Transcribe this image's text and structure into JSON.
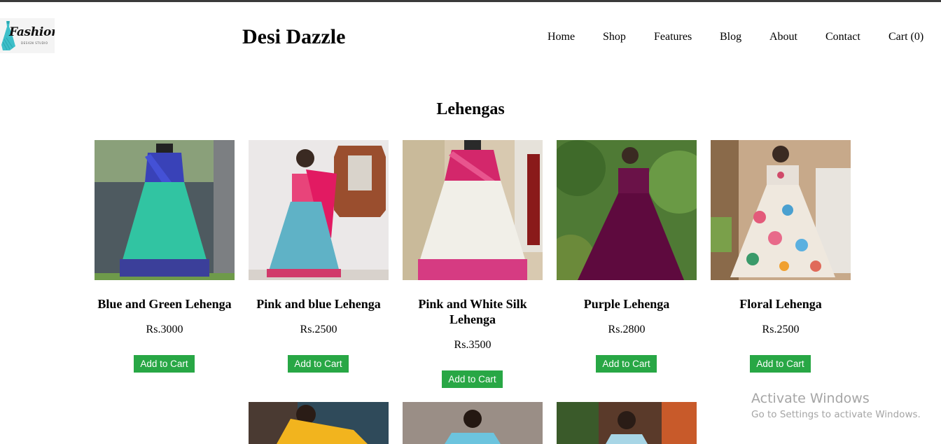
{
  "header": {
    "logo": {
      "text": "Fashion",
      "subtext": "DESIGN STUDIO",
      "icon": "dress-logo-icon"
    },
    "brand": "Desi Dazzle",
    "nav": [
      "Home",
      "Shop",
      "Features",
      "Blog",
      "About",
      "Contact",
      "Cart (0)"
    ]
  },
  "section": {
    "title": "Lehengas"
  },
  "products": [
    {
      "name": "Blue and Green Lehenga",
      "price": "Rs.3000",
      "button": "Add to Cart"
    },
    {
      "name": "Pink and blue Lehenga",
      "price": "Rs.2500",
      "button": "Add to Cart"
    },
    {
      "name": "Pink and White Silk Lehenga",
      "price": "Rs.3500",
      "button": "Add to Cart"
    },
    {
      "name": "Purple Lehenga",
      "price": "Rs.2800",
      "button": "Add to Cart"
    },
    {
      "name": "Floral Lehenga",
      "price": "Rs.2500",
      "button": "Add to Cart"
    }
  ],
  "watermark": {
    "line1": "Activate Windows",
    "line2": "Go to Settings to activate Windows."
  },
  "colors": {
    "button": "#28a745",
    "text": "#000000",
    "top_bar": "#3a3a3a"
  }
}
